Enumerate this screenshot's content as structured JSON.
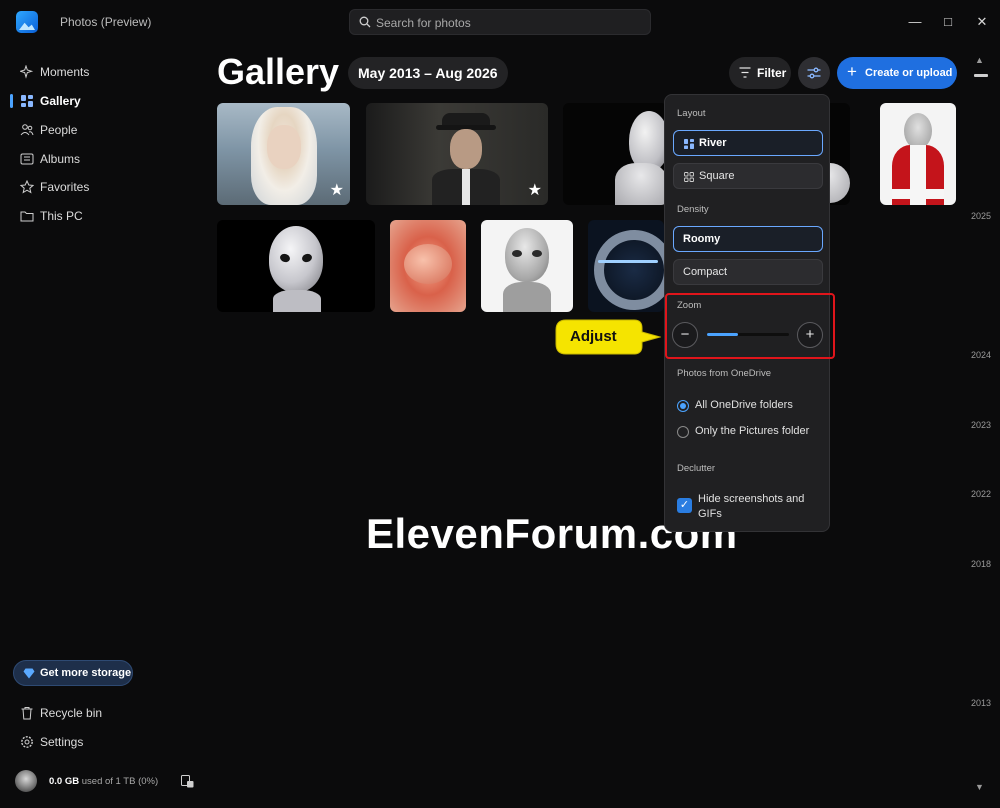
{
  "app": {
    "title": "Photos (Preview)",
    "search_placeholder": "Search for photos",
    "window_controls": [
      "minimize",
      "maximize",
      "close"
    ]
  },
  "sidebar": {
    "items": [
      {
        "label": "Moments",
        "icon": "sparkle-icon"
      },
      {
        "label": "Gallery",
        "icon": "gallery-icon",
        "active": true
      },
      {
        "label": "People",
        "icon": "people-icon"
      },
      {
        "label": "Albums",
        "icon": "album-icon"
      },
      {
        "label": "Favorites",
        "icon": "star-icon"
      },
      {
        "label": "This PC",
        "icon": "folder-icon"
      }
    ],
    "storage_button": "Get more storage",
    "bottom_items": [
      {
        "label": "Recycle bin",
        "icon": "trash-icon"
      },
      {
        "label": "Settings",
        "icon": "gear-icon"
      }
    ],
    "usage_amount": "0.0 GB",
    "usage_rest": "used of 1 TB (0%)"
  },
  "header": {
    "title": "Gallery",
    "date_range": "May 2013 – Aug 2026",
    "filter_label": "Filter",
    "create_label": "Create or upload"
  },
  "timeline": {
    "years": [
      "2025",
      "2024",
      "2023",
      "2022",
      "2018",
      "2013"
    ]
  },
  "photos": {
    "row1_favorites": [
      "photo-1",
      "photo-2"
    ]
  },
  "popup": {
    "layout_label": "Layout",
    "layout_options": [
      "River",
      "Square"
    ],
    "layout_selected": "River",
    "density_label": "Density",
    "density_options": [
      "Roomy",
      "Compact"
    ],
    "density_selected": "Roomy",
    "zoom_label": "Zoom",
    "zoom_level": 0.38,
    "onedrive_label": "Photos from OneDrive",
    "onedrive_options": [
      "All OneDrive folders",
      "Only the Pictures folder"
    ],
    "onedrive_selected": "All OneDrive folders",
    "declutter_label": "Declutter",
    "declutter_option": "Hide screenshots and GIFs",
    "declutter_checked": true
  },
  "callout": "Adjust",
  "watermark": "ElevenForum.com",
  "colors": {
    "accent": "#1f6fe0",
    "highlight_box": "#e0151b",
    "callout": "#f5e400"
  }
}
